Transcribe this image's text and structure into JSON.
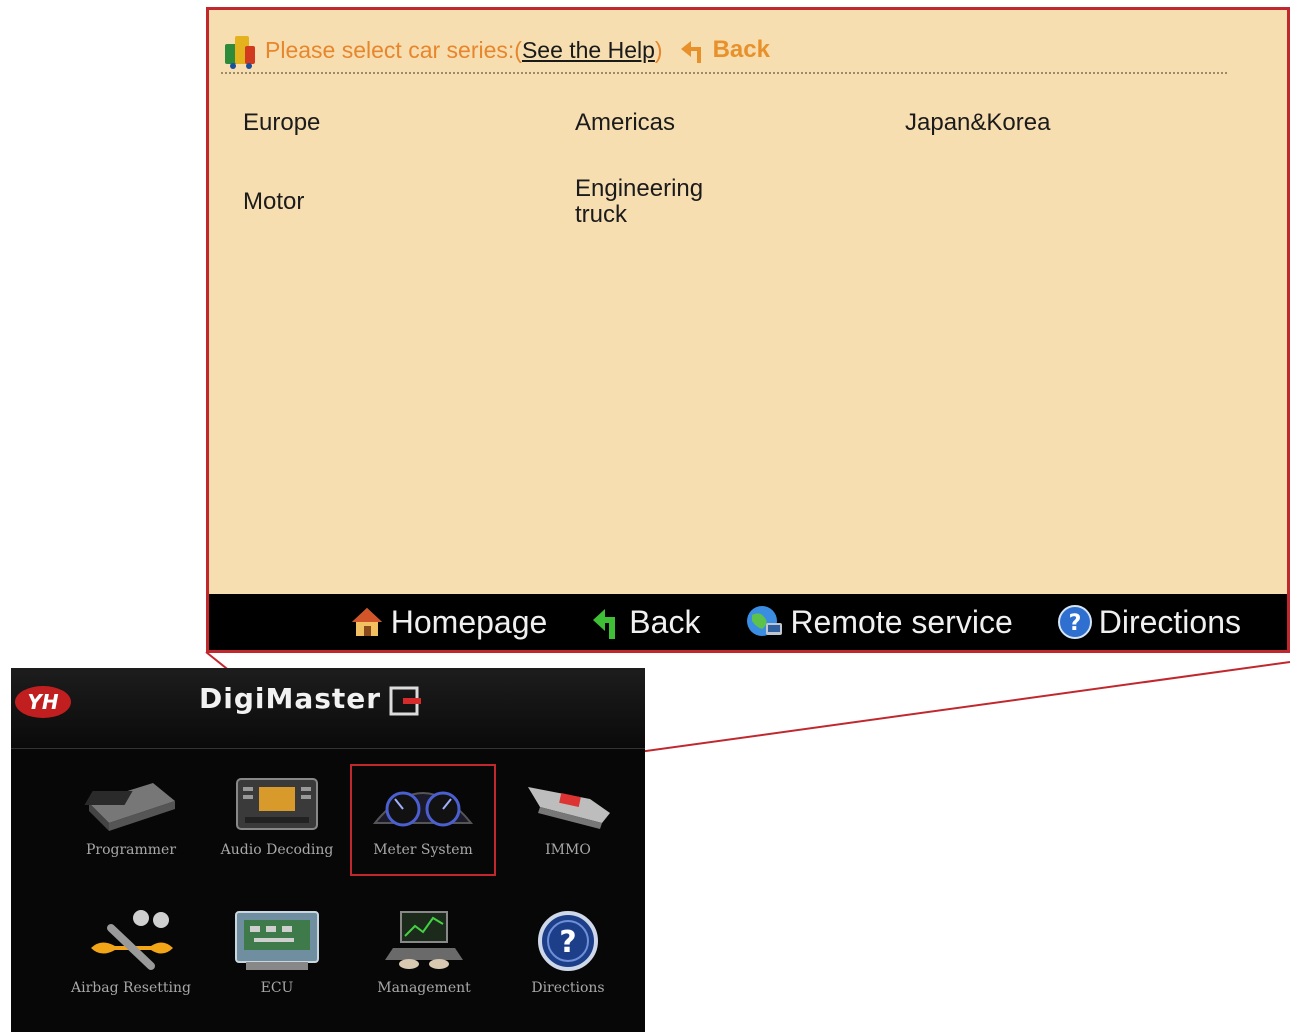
{
  "panel": {
    "prompt": "Please select car series:(",
    "help_link": "See the Help",
    "paren_close": ")",
    "back_label": "Back",
    "series": [
      "Europe",
      "Americas",
      "Japan&Korea",
      "Motor",
      "Engineering truck"
    ],
    "bottom_nav": [
      {
        "label": "Homepage",
        "icon": "home-icon"
      },
      {
        "label": "Back",
        "icon": "back-arrow-icon"
      },
      {
        "label": "Remote service",
        "icon": "globe-icon"
      },
      {
        "label": "Directions",
        "icon": "question-icon"
      }
    ]
  },
  "digimaster": {
    "title": "DigiMaster",
    "brand_cn": "",
    "tiles": [
      {
        "label": "Programmer",
        "icon": "programmer-icon"
      },
      {
        "label": "Audio Decoding",
        "icon": "audio-icon"
      },
      {
        "label": "Meter System",
        "icon": "meter-icon",
        "selected": true
      },
      {
        "label": "IMMO",
        "icon": "immo-key-icon"
      },
      {
        "label": "Airbag Resetting",
        "icon": "wrench-icon"
      },
      {
        "label": "ECU",
        "icon": "ecu-board-icon"
      },
      {
        "label": "Management",
        "icon": "laptop-icon"
      },
      {
        "label": "Directions",
        "icon": "help-circle-icon"
      }
    ]
  },
  "colors": {
    "panel_bg": "#f6deb1",
    "highlight_border": "#c0282e",
    "prompt_orange": "#e8862c",
    "nav_bar": "#000000"
  }
}
